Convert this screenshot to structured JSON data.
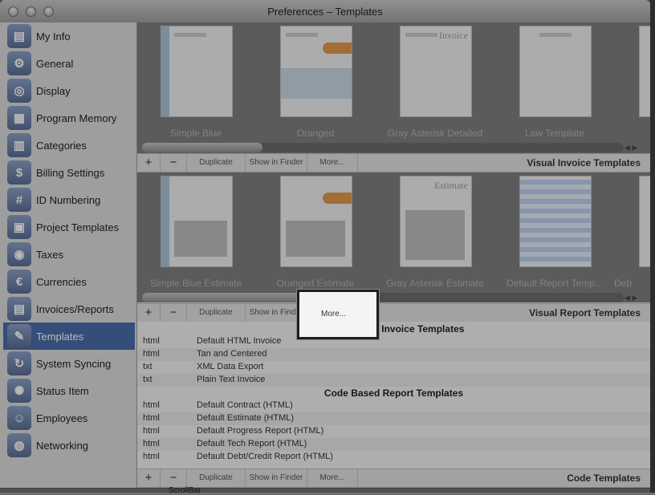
{
  "window": {
    "title": "Preferences – Templates"
  },
  "sidebar": {
    "items": [
      {
        "label": "My Info",
        "icon": "id-card-icon"
      },
      {
        "label": "General",
        "icon": "gears-icon"
      },
      {
        "label": "Display",
        "icon": "glasses-icon"
      },
      {
        "label": "Program Memory",
        "icon": "memory-icon"
      },
      {
        "label": "Categories",
        "icon": "categories-icon"
      },
      {
        "label": "Billing Settings",
        "icon": "dollar-arrow-icon"
      },
      {
        "label": "ID Numbering",
        "icon": "counter-icon"
      },
      {
        "label": "Project Templates",
        "icon": "project-icon"
      },
      {
        "label": "Taxes",
        "icon": "coins-icon"
      },
      {
        "label": "Currencies",
        "icon": "currency-icon"
      },
      {
        "label": "Invoices/Reports",
        "icon": "document-icon"
      },
      {
        "label": "Templates",
        "icon": "pencil-icon"
      },
      {
        "label": "System Syncing",
        "icon": "sync-icon"
      },
      {
        "label": "Status Item",
        "icon": "lightbulb-icon"
      },
      {
        "label": "Employees",
        "icon": "people-icon"
      },
      {
        "label": "Networking",
        "icon": "globe-icon"
      }
    ],
    "selected": "Templates"
  },
  "invoice_templates": {
    "thumbs": [
      "Simple Blue",
      "Oranged",
      "Gray Asterisk Detailed",
      "Law Template"
    ],
    "thumb_text": {
      "invoice": "Invoice"
    },
    "toolbar": {
      "add": "+",
      "remove": "−",
      "duplicate": "Duplicate",
      "show_in_finder": "Show in Finder",
      "more": "More...",
      "title": "Visual Invoice Templates"
    }
  },
  "report_templates": {
    "thumbs": [
      "Simple Blue Estimate",
      "Oranged Estimate",
      "Gray Asterisk Estimate",
      "Default Report Temp...",
      "Deb"
    ],
    "thumb_text": {
      "estimate": "Estimate"
    },
    "toolbar": {
      "duplicate": "Duplicate",
      "show_in_finder": "Show in Finder",
      "more": "More...",
      "title": "Visual Report Templates"
    }
  },
  "code_based": {
    "invoice_header": "Code Based Invoice Templates",
    "invoice_rows": [
      {
        "ext": "html",
        "name": "Default HTML Invoice"
      },
      {
        "ext": "html",
        "name": "Tan and Centered"
      },
      {
        "ext": "txt",
        "name": "XML Data Export"
      },
      {
        "ext": "txt",
        "name": "Plain Text Invoice"
      }
    ],
    "report_header": "Code Based Report Templates",
    "report_rows": [
      {
        "ext": "html",
        "name": "Default Contract (HTML)"
      },
      {
        "ext": "html",
        "name": "Default Estimate (HTML)"
      },
      {
        "ext": "html",
        "name": "Default Progress Report (HTML)"
      },
      {
        "ext": "html",
        "name": "Default Tech Report (HTML)"
      },
      {
        "ext": "html",
        "name": "Default Debt/Credit Report (HTML)"
      }
    ],
    "toolbar": {
      "add": "+",
      "remove": "−",
      "duplicate": "Duplicate",
      "show_in_finder": "Show in Finder",
      "more": "More...",
      "title": "Code Templates"
    }
  },
  "below_window": {
    "text": "ScrollBar"
  }
}
